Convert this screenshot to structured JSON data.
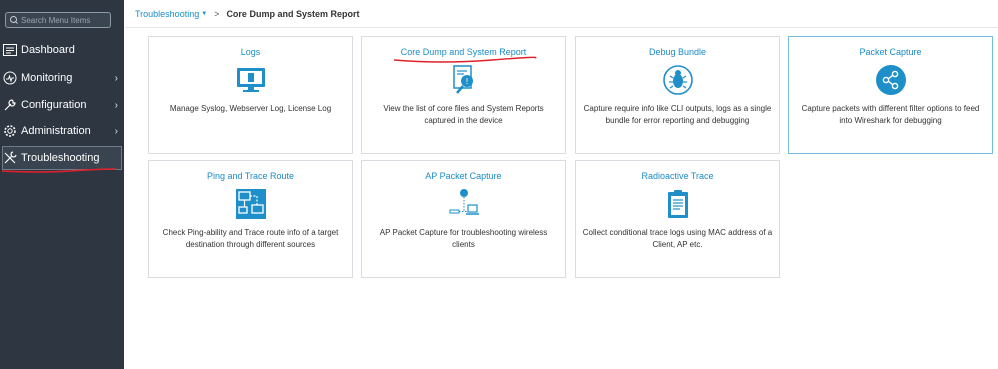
{
  "sidebar": {
    "search_placeholder": "Search Menu Items",
    "items": [
      {
        "label": "Dashboard",
        "icon": "dashboard-icon",
        "has_submenu": false
      },
      {
        "label": "Monitoring",
        "icon": "monitoring-icon",
        "has_submenu": true
      },
      {
        "label": "Configuration",
        "icon": "wrench-icon",
        "has_submenu": true
      },
      {
        "label": "Administration",
        "icon": "gear-icon",
        "has_submenu": true
      },
      {
        "label": "Troubleshooting",
        "icon": "tools-icon",
        "has_submenu": false,
        "active": true
      }
    ],
    "chevron": "›"
  },
  "breadcrumb": {
    "parent": "Troubleshooting",
    "separator": ">",
    "current": "Core Dump and System Report"
  },
  "cards": [
    {
      "title": "Logs",
      "icon": "monitor-icon",
      "description": "Manage Syslog, Webserver Log, License Log"
    },
    {
      "title": "Core Dump and System Report",
      "icon": "report-search-icon",
      "description": "View the list of core files and System Reports captured in the device"
    },
    {
      "title": "Debug Bundle",
      "icon": "bug-icon",
      "description": "Capture require info like CLI outputs, logs as a single bundle for error reporting and debugging"
    },
    {
      "title": "Packet Capture",
      "icon": "share-nodes-icon",
      "description": "Capture packets with different filter options to feed into Wireshark for debugging",
      "selected": true
    },
    {
      "title": "Ping and Trace Route",
      "icon": "network-monitors-icon",
      "description": "Check Ping-ability and Trace route info of a target destination through different sources"
    },
    {
      "title": "AP Packet Capture",
      "icon": "ap-laptop-icon",
      "description": "AP Packet Capture for troubleshooting wireless clients"
    },
    {
      "title": "Radioactive Trace",
      "icon": "clipboard-icon",
      "description": "Collect conditional trace logs using MAC address of a Client, AP etc."
    }
  ],
  "colors": {
    "sidebar_bg": "#2d3641",
    "link_blue": "#1a8bc6",
    "icon_blue": "#1f8fc9",
    "annotation_red": "#e0202a"
  }
}
